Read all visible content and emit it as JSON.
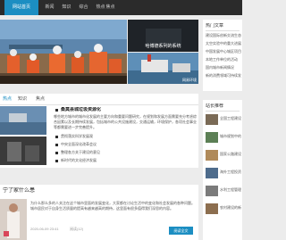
{
  "nav": {
    "items": [
      "网站首页",
      "新闻",
      "知识",
      "综合",
      "热点",
      "焦点"
    ],
    "active": 0
  },
  "hero": {
    "side_top_caption": "哈博德系列的系统",
    "badge": "网易环境"
  },
  "sidebar": {
    "hot_title": "热门文章",
    "hot_items": [
      "建设国际创新交流生态会议",
      "太空实验中的重大进展",
      "中国发展中心城区项目",
      "本地工作单位的活动",
      "国内城市新闻情况",
      "新的消费领域可持续发展"
    ],
    "recommend_title": "站长推荐",
    "recommend_items": [
      "全国工程建设领域的重大项目通报",
      "城市规划中的绿色发展进展",
      "国家公路建设的最新动态报告",
      "海外工程投资项目进展顺利",
      "水利工程管理工作进一步推进",
      "农村建设的新成就与新经验"
    ]
  },
  "news": {
    "tabs": [
      "热点",
      "知识",
      "焦点"
    ],
    "headline": "桑莫县城垃圾资源化",
    "summary": "哪些地方城市的城市化发展的主要方向和重要问题研究，在规划和发展方面需要充分考虑综合因素以及长期持续发展，包括城市的公共设施建设，交通运输，环境保护，各项社会事业等都需要进一步完善提升。",
    "list": [
      "贯彻落实科学发展观",
      "中央全面深化改革会议",
      "整理各方关于建设的意见",
      "新时代的文化经济发展"
    ]
  },
  "feature": {
    "title": "宁了家什么患",
    "text": "为什么那么多的人关注在这个城市里面的发展变化，大家都在讨论生活中的变化和社会发展的各种问题。城市居民对于自身生活质量的提高有越来越高的期待，这里面有很多值得我们深思的内容。",
    "date": "2020-06-09 23:41",
    "views": "阅读(12)",
    "more_button": "阅读全文"
  }
}
